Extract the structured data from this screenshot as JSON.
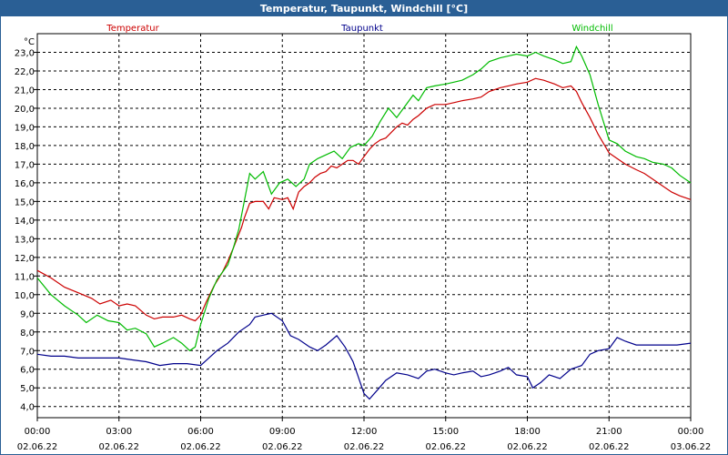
{
  "window": {
    "title": "Temperatur, Taupunkt, Windchill [°C]"
  },
  "chart_data": {
    "type": "line",
    "title": "Temperatur, Taupunkt, Windchill [°C]",
    "ylabel": "°C",
    "xlabel": "",
    "ylim": [
      3.4,
      24.0
    ],
    "y_ticks": [
      "4,0",
      "5,0",
      "6,0",
      "7,0",
      "8,0",
      "9,0",
      "10,0",
      "11,0",
      "12,0",
      "13,0",
      "14,0",
      "15,0",
      "16,0",
      "17,0",
      "18,0",
      "19,0",
      "20,0",
      "21,0",
      "22,0",
      "23,0"
    ],
    "x_range_hours": [
      0,
      24
    ],
    "x_ticks": [
      {
        "time": "00:00",
        "date": "02.06.22"
      },
      {
        "time": "03:00",
        "date": "02.06.22"
      },
      {
        "time": "06:00",
        "date": "02.06.22"
      },
      {
        "time": "09:00",
        "date": "02.06.22"
      },
      {
        "time": "12:00",
        "date": "02.06.22"
      },
      {
        "time": "15:00",
        "date": "02.06.22"
      },
      {
        "time": "18:00",
        "date": "02.06.22"
      },
      {
        "time": "21:00",
        "date": "02.06.22"
      },
      {
        "time": "00:00",
        "date": "03.06.22"
      }
    ],
    "grid": true,
    "legend_placement": "top",
    "series": [
      {
        "name": "Temperatur",
        "color": "#cc0000",
        "points": [
          [
            0,
            11.3
          ],
          [
            0.5,
            10.9
          ],
          [
            1,
            10.4
          ],
          [
            1.5,
            10.1
          ],
          [
            2,
            9.8
          ],
          [
            2.3,
            9.5
          ],
          [
            2.7,
            9.7
          ],
          [
            3,
            9.4
          ],
          [
            3.3,
            9.5
          ],
          [
            3.6,
            9.4
          ],
          [
            4,
            8.9
          ],
          [
            4.3,
            8.7
          ],
          [
            4.6,
            8.8
          ],
          [
            5,
            8.8
          ],
          [
            5.3,
            8.9
          ],
          [
            5.6,
            8.7
          ],
          [
            5.8,
            8.6
          ],
          [
            6,
            8.9
          ],
          [
            6.2,
            9.6
          ],
          [
            6.5,
            10.5
          ],
          [
            6.8,
            11.2
          ],
          [
            7,
            11.8
          ],
          [
            7.2,
            12.5
          ],
          [
            7.5,
            13.6
          ],
          [
            7.6,
            14.1
          ],
          [
            7.8,
            14.9
          ],
          [
            8,
            15.0
          ],
          [
            8.3,
            15.0
          ],
          [
            8.5,
            14.6
          ],
          [
            8.7,
            15.2
          ],
          [
            9,
            15.1
          ],
          [
            9.2,
            15.2
          ],
          [
            9.4,
            14.6
          ],
          [
            9.6,
            15.5
          ],
          [
            9.8,
            15.8
          ],
          [
            10,
            16.0
          ],
          [
            10.2,
            16.3
          ],
          [
            10.4,
            16.5
          ],
          [
            10.6,
            16.6
          ],
          [
            10.8,
            16.9
          ],
          [
            11,
            16.8
          ],
          [
            11.2,
            17.0
          ],
          [
            11.4,
            17.2
          ],
          [
            11.6,
            17.2
          ],
          [
            11.8,
            17.0
          ],
          [
            12,
            17.4
          ],
          [
            12.2,
            17.8
          ],
          [
            12.4,
            18.1
          ],
          [
            12.6,
            18.3
          ],
          [
            12.8,
            18.4
          ],
          [
            13,
            18.7
          ],
          [
            13.2,
            19.0
          ],
          [
            13.4,
            19.2
          ],
          [
            13.6,
            19.1
          ],
          [
            13.8,
            19.4
          ],
          [
            14,
            19.6
          ],
          [
            14.3,
            20.0
          ],
          [
            14.6,
            20.2
          ],
          [
            15,
            20.2
          ],
          [
            15.3,
            20.3
          ],
          [
            15.6,
            20.4
          ],
          [
            16,
            20.5
          ],
          [
            16.3,
            20.6
          ],
          [
            16.6,
            20.9
          ],
          [
            17,
            21.1
          ],
          [
            17.3,
            21.2
          ],
          [
            17.6,
            21.3
          ],
          [
            18,
            21.4
          ],
          [
            18.3,
            21.6
          ],
          [
            18.6,
            21.5
          ],
          [
            19,
            21.3
          ],
          [
            19.3,
            21.1
          ],
          [
            19.6,
            21.2
          ],
          [
            19.8,
            20.9
          ],
          [
            20,
            20.3
          ],
          [
            20.3,
            19.5
          ],
          [
            20.6,
            18.6
          ],
          [
            21,
            17.6
          ],
          [
            21.3,
            17.3
          ],
          [
            21.6,
            17.0
          ],
          [
            22,
            16.7
          ],
          [
            22.3,
            16.5
          ],
          [
            22.6,
            16.2
          ],
          [
            23,
            15.8
          ],
          [
            23.3,
            15.5
          ],
          [
            23.6,
            15.3
          ],
          [
            24,
            15.1
          ]
        ]
      },
      {
        "name": "Taupunkt",
        "color": "#00008b",
        "points": [
          [
            0,
            6.8
          ],
          [
            0.5,
            6.7
          ],
          [
            1,
            6.7
          ],
          [
            1.5,
            6.6
          ],
          [
            2,
            6.6
          ],
          [
            2.5,
            6.6
          ],
          [
            3,
            6.6
          ],
          [
            3.5,
            6.5
          ],
          [
            4,
            6.4
          ],
          [
            4.5,
            6.2
          ],
          [
            5,
            6.3
          ],
          [
            5.5,
            6.3
          ],
          [
            6,
            6.2
          ],
          [
            6.3,
            6.6
          ],
          [
            6.6,
            7.0
          ],
          [
            7,
            7.4
          ],
          [
            7.4,
            8.0
          ],
          [
            7.8,
            8.4
          ],
          [
            8,
            8.8
          ],
          [
            8.3,
            8.9
          ],
          [
            8.6,
            9.0
          ],
          [
            9,
            8.6
          ],
          [
            9.3,
            7.8
          ],
          [
            9.6,
            7.6
          ],
          [
            10,
            7.2
          ],
          [
            10.3,
            7.0
          ],
          [
            10.6,
            7.3
          ],
          [
            11,
            7.8
          ],
          [
            11.3,
            7.2
          ],
          [
            11.6,
            6.4
          ],
          [
            12,
            4.7
          ],
          [
            12.2,
            4.4
          ],
          [
            12.5,
            4.9
          ],
          [
            12.8,
            5.4
          ],
          [
            13.2,
            5.8
          ],
          [
            13.6,
            5.7
          ],
          [
            14,
            5.5
          ],
          [
            14.3,
            5.9
          ],
          [
            14.6,
            6.0
          ],
          [
            15,
            5.8
          ],
          [
            15.3,
            5.7
          ],
          [
            15.6,
            5.8
          ],
          [
            16,
            5.9
          ],
          [
            16.3,
            5.6
          ],
          [
            16.6,
            5.7
          ],
          [
            17,
            5.9
          ],
          [
            17.3,
            6.1
          ],
          [
            17.6,
            5.7
          ],
          [
            18,
            5.6
          ],
          [
            18.2,
            5.0
          ],
          [
            18.5,
            5.3
          ],
          [
            18.8,
            5.7
          ],
          [
            19.2,
            5.5
          ],
          [
            19.6,
            6.0
          ],
          [
            20,
            6.2
          ],
          [
            20.3,
            6.8
          ],
          [
            20.6,
            7.0
          ],
          [
            21,
            7.1
          ],
          [
            21.3,
            7.7
          ],
          [
            21.6,
            7.5
          ],
          [
            22,
            7.3
          ],
          [
            22.5,
            7.3
          ],
          [
            23,
            7.3
          ],
          [
            23.5,
            7.3
          ],
          [
            24,
            7.4
          ]
        ]
      },
      {
        "name": "Windchill",
        "color": "#00bb00",
        "points": [
          [
            0,
            10.9
          ],
          [
            0.5,
            10.0
          ],
          [
            1,
            9.4
          ],
          [
            1.5,
            8.9
          ],
          [
            1.8,
            8.5
          ],
          [
            2.2,
            8.9
          ],
          [
            2.6,
            8.6
          ],
          [
            3,
            8.5
          ],
          [
            3.3,
            8.1
          ],
          [
            3.6,
            8.2
          ],
          [
            4,
            7.9
          ],
          [
            4.3,
            7.2
          ],
          [
            4.6,
            7.4
          ],
          [
            5,
            7.7
          ],
          [
            5.3,
            7.4
          ],
          [
            5.6,
            7.0
          ],
          [
            5.8,
            7.2
          ],
          [
            6,
            8.4
          ],
          [
            6.3,
            9.8
          ],
          [
            6.6,
            10.8
          ],
          [
            7,
            11.6
          ],
          [
            7.2,
            12.5
          ],
          [
            7.4,
            13.5
          ],
          [
            7.6,
            15.0
          ],
          [
            7.8,
            16.5
          ],
          [
            8,
            16.2
          ],
          [
            8.3,
            16.6
          ],
          [
            8.6,
            15.4
          ],
          [
            8.9,
            16.0
          ],
          [
            9.2,
            16.2
          ],
          [
            9.5,
            15.8
          ],
          [
            9.8,
            16.2
          ],
          [
            10,
            17.0
          ],
          [
            10.3,
            17.3
          ],
          [
            10.6,
            17.5
          ],
          [
            10.9,
            17.7
          ],
          [
            11.2,
            17.3
          ],
          [
            11.5,
            17.9
          ],
          [
            11.8,
            18.1
          ],
          [
            12,
            18.0
          ],
          [
            12.3,
            18.5
          ],
          [
            12.6,
            19.3
          ],
          [
            12.9,
            20.0
          ],
          [
            13.2,
            19.5
          ],
          [
            13.5,
            20.1
          ],
          [
            13.8,
            20.7
          ],
          [
            14,
            20.4
          ],
          [
            14.3,
            21.1
          ],
          [
            14.6,
            21.2
          ],
          [
            15,
            21.3
          ],
          [
            15.3,
            21.4
          ],
          [
            15.6,
            21.5
          ],
          [
            16,
            21.8
          ],
          [
            16.3,
            22.1
          ],
          [
            16.6,
            22.5
          ],
          [
            17,
            22.7
          ],
          [
            17.3,
            22.8
          ],
          [
            17.6,
            22.9
          ],
          [
            18,
            22.8
          ],
          [
            18.3,
            23.0
          ],
          [
            18.6,
            22.8
          ],
          [
            19,
            22.6
          ],
          [
            19.3,
            22.4
          ],
          [
            19.6,
            22.5
          ],
          [
            19.8,
            23.3
          ],
          [
            20,
            22.8
          ],
          [
            20.3,
            21.8
          ],
          [
            20.6,
            20.2
          ],
          [
            21,
            18.3
          ],
          [
            21.3,
            18.1
          ],
          [
            21.6,
            17.7
          ],
          [
            22,
            17.4
          ],
          [
            22.3,
            17.3
          ],
          [
            22.6,
            17.1
          ],
          [
            23,
            17.0
          ],
          [
            23.3,
            16.8
          ],
          [
            23.6,
            16.4
          ],
          [
            24,
            16.0
          ]
        ]
      }
    ]
  }
}
